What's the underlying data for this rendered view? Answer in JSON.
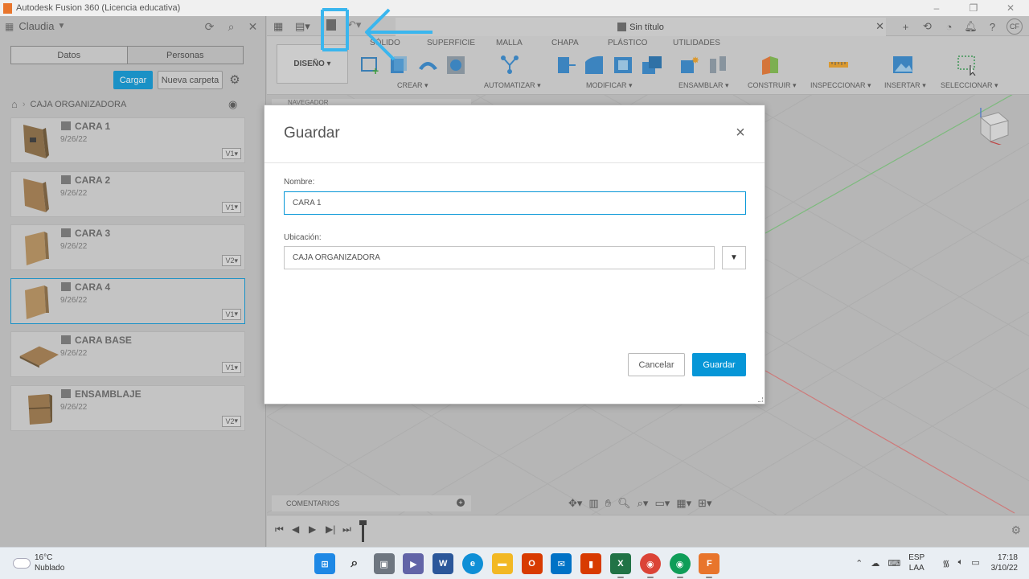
{
  "window": {
    "title": "Autodesk Fusion 360 (Licencia educativa)"
  },
  "data_panel": {
    "user": "Claudia",
    "tabs": [
      "Datos",
      "Personas"
    ],
    "upload_label": "Cargar",
    "new_folder_label": "Nueva carpeta",
    "breadcrumb_folder": "CAJA ORGANIZADORA",
    "files": [
      {
        "name": "CARA 1",
        "date": "9/26/22",
        "version": "V1"
      },
      {
        "name": "CARA 2",
        "date": "9/26/22",
        "version": "V1"
      },
      {
        "name": "CARA 3",
        "date": "9/26/22",
        "version": "V2"
      },
      {
        "name": "CARA 4",
        "date": "9/26/22",
        "version": "V1"
      },
      {
        "name": "CARA BASE",
        "date": "9/26/22",
        "version": "V1"
      },
      {
        "name": "ENSAMBLAJE",
        "date": "9/26/22",
        "version": "V2"
      }
    ]
  },
  "document": {
    "tab_title": "Sin título"
  },
  "ribbon": {
    "workspace": "DISEÑO",
    "tabs": [
      "SÓLIDO",
      "SUPERFICIE",
      "MALLA",
      "CHAPA",
      "PLÁSTICO",
      "UTILIDADES"
    ],
    "groups": [
      "CREAR",
      "AUTOMATIZAR",
      "MODIFICAR",
      "ENSAMBLAR",
      "CONSTRUIR",
      "INSPECCIONAR",
      "INSERTAR",
      "SELECCIONAR"
    ]
  },
  "viewport": {
    "navigator_label": "NAVEGADOR",
    "comments_label": "COMENTARIOS"
  },
  "dialog": {
    "title": "Guardar",
    "name_label": "Nombre:",
    "name_value": "CARA 1",
    "location_label": "Ubicación:",
    "location_value": "CAJA ORGANIZADORA",
    "cancel_label": "Cancelar",
    "save_label": "Guardar"
  },
  "taskbar": {
    "temperature": "16°C",
    "weather": "Nublado",
    "lang_top": "ESP",
    "lang_bottom": "LAA",
    "time": "17:18",
    "date": "3/10/22"
  },
  "colors": {
    "accent": "#0696d7",
    "annotation": "#3ab6ee"
  }
}
